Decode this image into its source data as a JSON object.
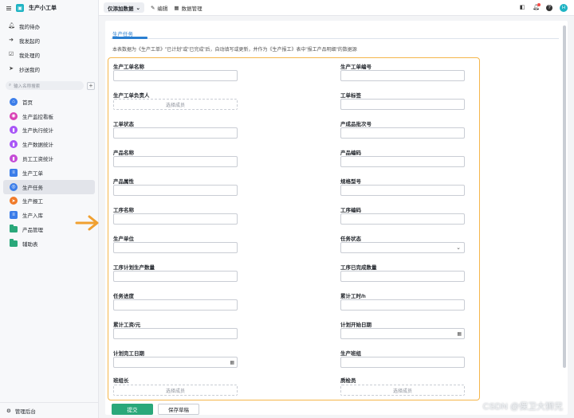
{
  "app": {
    "title": "生产小工单",
    "logo_glyph": "☰"
  },
  "sidebar": {
    "top_items": [
      {
        "label": "我的待办",
        "icon": "bell-icon"
      },
      {
        "label": "我发起的",
        "icon": "send-circle-icon"
      },
      {
        "label": "我处理的",
        "icon": "check-box-icon"
      },
      {
        "label": "抄送我的",
        "icon": "paper-plane-icon"
      }
    ],
    "search_placeholder": "输入名称搜索",
    "menu": [
      {
        "label": "首页",
        "icon": "home-icon",
        "color": "#3b7de9"
      },
      {
        "label": "生产监控看板",
        "icon": "dashboard-icon",
        "color": "#d941b5"
      },
      {
        "label": "生产执行统计",
        "icon": "chart-icon",
        "color": "#a855f7"
      },
      {
        "label": "生产数据统计",
        "icon": "chart-icon",
        "color": "#a855f7"
      },
      {
        "label": "员工工资统计",
        "icon": "chart-icon",
        "color": "#c44bd6"
      },
      {
        "label": "生产工单",
        "icon": "doc-icon",
        "color": "#3b7de9"
      },
      {
        "label": "生产任务",
        "icon": "target-icon",
        "color": "#3b7de9",
        "active": true
      },
      {
        "label": "生产报工",
        "icon": "send-icon",
        "color": "#f07b2a"
      },
      {
        "label": "生产入库",
        "icon": "doc-icon",
        "color": "#3b7de9"
      },
      {
        "label": "产品管理",
        "icon": "folder-icon",
        "color": "#2aa87a"
      },
      {
        "label": "辅助表",
        "icon": "folder-icon",
        "color": "#2aa87a"
      }
    ],
    "footer": "管理后台"
  },
  "topbar": {
    "view": "仅添加数据",
    "edit": "编辑",
    "data_manage": "数据管理",
    "avatar": "H"
  },
  "form": {
    "tab": "生产任务",
    "description": "本表数据为《生产工单》\"已计划\"或\"已完成\"后，自动填写或更新，并作为《生产报工》表中\"报工产品明细\"的数据源",
    "member_placeholder": "选择成员",
    "left_fields": [
      "生产工单名称",
      "生产工单负责人",
      "工单状态",
      "产品名称",
      "产品属性",
      "工序名称",
      "生产单位",
      "工序计划生产数量",
      "任务进度",
      "累计工资/元",
      "计划完工日期",
      "班组长"
    ],
    "right_fields": [
      "生产工单编号",
      "工单标签",
      "产成品批次号",
      "产品编码",
      "规格型号",
      "工序编码",
      "任务状态",
      "工序已完成数量",
      "累计工时/h",
      "计划开始日期",
      "生产班组",
      "质检员"
    ],
    "submit": "提交",
    "save_draft": "保存草稿"
  },
  "watermark": "CSDN @保卫大狮兄",
  "colors": {
    "accent": "#2aa87a",
    "highlight": "#f5b64b",
    "arrow": "#f0a030",
    "link": "#2a7fd1"
  }
}
